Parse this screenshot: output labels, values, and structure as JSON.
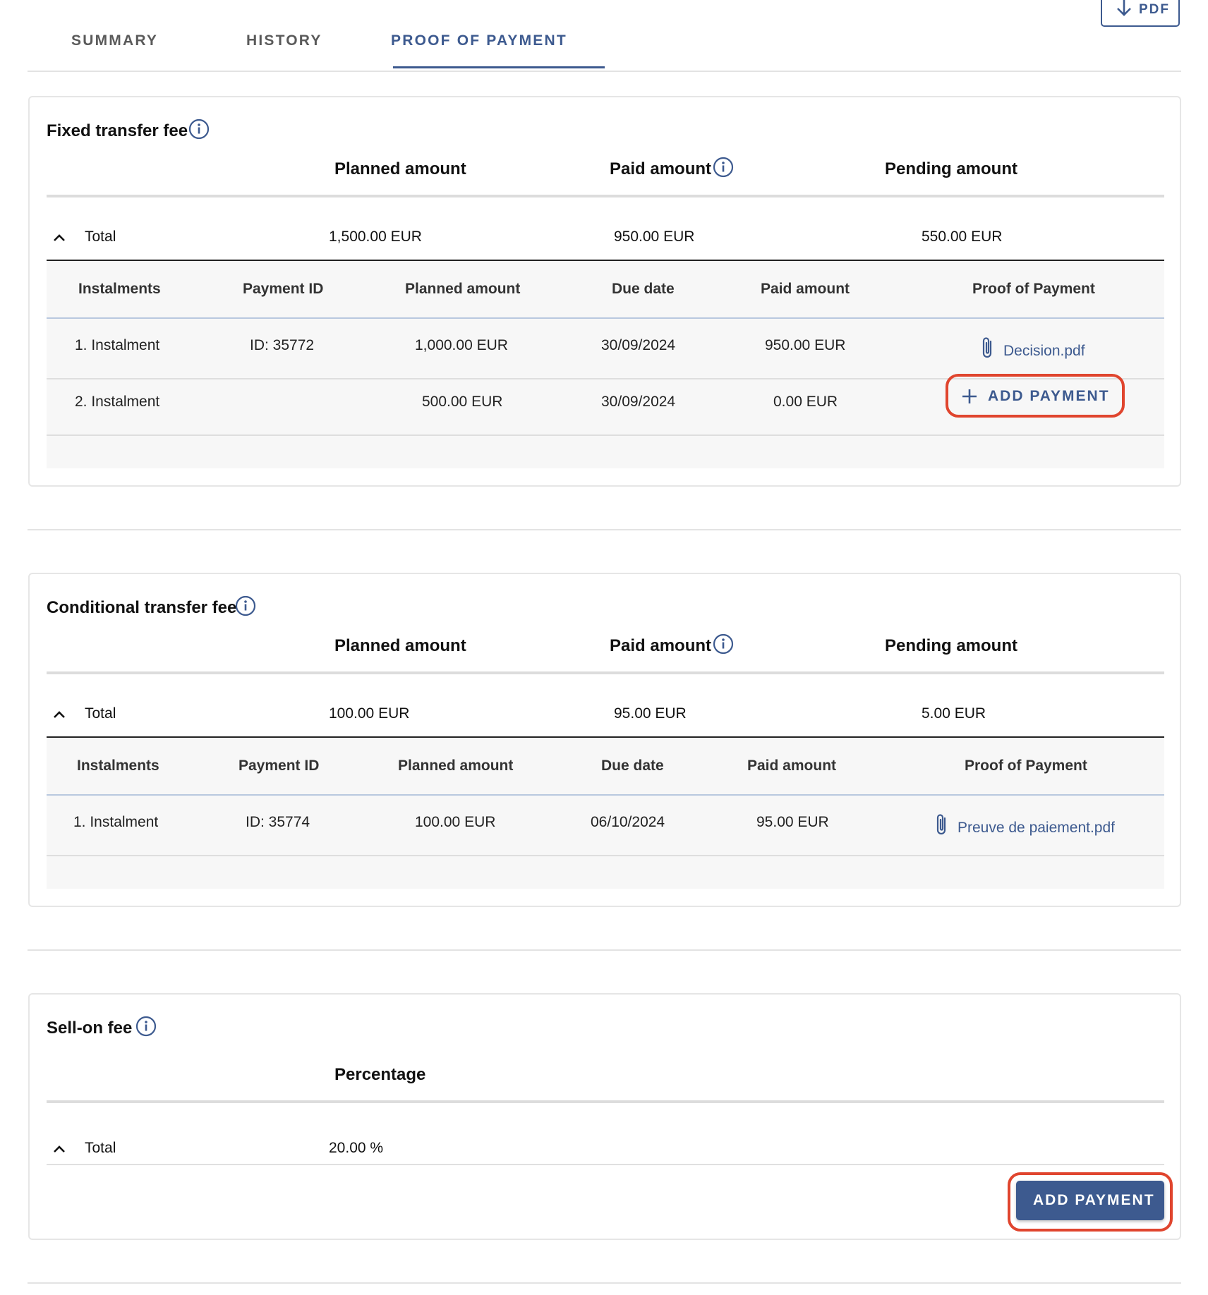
{
  "tabs": [
    {
      "label": "SUMMARY"
    },
    {
      "label": "HISTORY"
    },
    {
      "label": "PROOF OF PAYMENT",
      "active": true
    }
  ],
  "pdf_button": {
    "label": "PDF",
    "icon": "arrow-down-icon"
  },
  "fixed": {
    "title": "Fixed transfer fee",
    "headers": {
      "planned": "Planned amount",
      "paid": "Paid amount",
      "pending": "Pending amount"
    },
    "total": {
      "label": "Total",
      "planned": "1,500.00 EUR",
      "paid": "950.00 EUR",
      "pending": "550.00 EUR"
    },
    "columns": [
      "Instalments",
      "Payment ID",
      "Planned amount",
      "Due date",
      "Paid amount",
      "Proof of Payment"
    ],
    "rows": [
      {
        "instalment": "1. Instalment",
        "payment_id": "ID: 35772",
        "planned": "1,000.00 EUR",
        "due": "30/09/2024",
        "paid": "950.00 EUR",
        "proof": "Decision.pdf"
      },
      {
        "instalment": "2. Instalment",
        "payment_id": "",
        "planned": "500.00 EUR",
        "due": "30/09/2024",
        "paid": "0.00 EUR",
        "action": "ADD PAYMENT"
      }
    ]
  },
  "conditional": {
    "title": "Conditional transfer fee",
    "headers": {
      "planned": "Planned amount",
      "paid": "Paid amount",
      "pending": "Pending amount"
    },
    "total": {
      "label": "Total",
      "planned": "100.00 EUR",
      "paid": "95.00 EUR",
      "pending": "5.00 EUR"
    },
    "columns": [
      "Instalments",
      "Payment ID",
      "Planned amount",
      "Due date",
      "Paid amount",
      "Proof of Payment"
    ],
    "rows": [
      {
        "instalment": "1. Instalment",
        "payment_id": "ID: 35774",
        "planned": "100.00 EUR",
        "due": "06/10/2024",
        "paid": "95.00 EUR",
        "proof": "Preuve de paiement.pdf"
      }
    ]
  },
  "sellon": {
    "title": "Sell-on fee",
    "headers": {
      "percentage": "Percentage"
    },
    "total": {
      "label": "Total",
      "percentage": "20.00 %"
    },
    "action": "ADD PAYMENT"
  },
  "colors": {
    "accent": "#3d5a8f",
    "highlight": "#e0452e"
  }
}
